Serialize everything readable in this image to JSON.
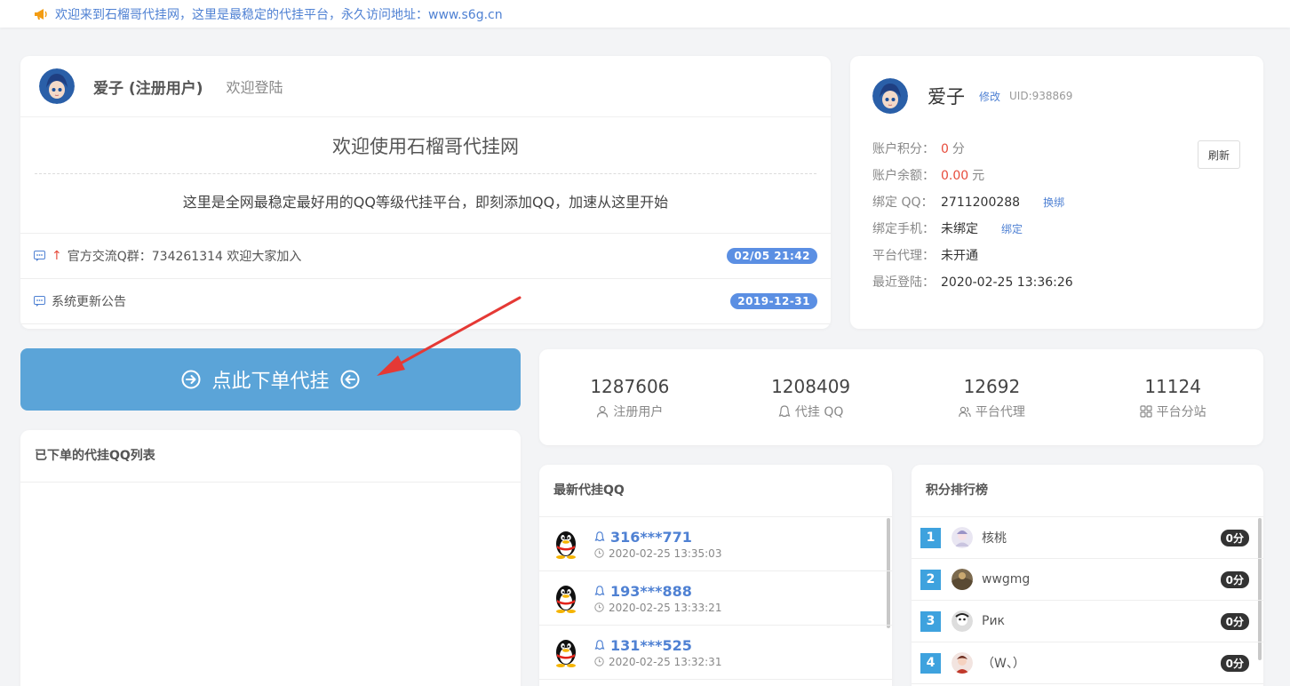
{
  "notice": {
    "text": "欢迎来到石榴哥代挂网，这里是最稳定的代挂平台，永久访问地址：www.s6g.cn"
  },
  "welcome": {
    "user_name": "爱子 (注册用户)",
    "welcome_text": "欢迎登陆",
    "title": "欢迎使用石榴哥代挂网",
    "description": "这里是全网最稳定最好用的QQ等级代挂平台，即刻添加QQ，加速从这里开始",
    "announcements": [
      {
        "text": "官方交流Q群：734261314 欢迎大家加入",
        "date": "02/05 21:42"
      },
      {
        "text": "系统更新公告",
        "date": "2019-12-31"
      }
    ]
  },
  "profile": {
    "name": "爱子",
    "edit_label": "修改",
    "uid": "UID:938869",
    "refresh_label": "刷新",
    "points_label": "账户积分：",
    "points_value": "0",
    "points_unit": "分",
    "balance_label": "账户余额：",
    "balance_value": "0.00",
    "balance_unit": "元",
    "qq_label": "绑定 QQ：",
    "qq_value": "2711200288",
    "qq_action": "换绑",
    "phone_label": "绑定手机：",
    "phone_value": "未绑定",
    "phone_action": "绑定",
    "agent_label": "平台代理：",
    "agent_value": "未开通",
    "login_label": "最近登陆：",
    "login_value": "2020-02-25 13:36:26"
  },
  "order_button": {
    "label": "点此下单代挂"
  },
  "stats": [
    {
      "value": "1287606",
      "label": "注册用户",
      "icon": "user-icon"
    },
    {
      "value": "1208409",
      "label": "代挂 QQ",
      "icon": "qq-icon"
    },
    {
      "value": "12692",
      "label": "平台代理",
      "icon": "users-icon"
    },
    {
      "value": "11124",
      "label": "平台分站",
      "icon": "grid-icon"
    }
  ],
  "order_list": {
    "title": "已下单的代挂QQ列表"
  },
  "latest": {
    "title": "最新代挂QQ",
    "items": [
      {
        "qq": "316***771",
        "time": "2020-02-25 13:35:03"
      },
      {
        "qq": "193***888",
        "time": "2020-02-25 13:33:21"
      },
      {
        "qq": "131***525",
        "time": "2020-02-25 13:32:31"
      }
    ]
  },
  "ranking": {
    "title": "积分排行榜",
    "items": [
      {
        "rank": "1",
        "name": "核桃",
        "score": "0分"
      },
      {
        "rank": "2",
        "name": "wwgmg",
        "score": "0分"
      },
      {
        "rank": "3",
        "name": "Рик",
        "score": "0分"
      },
      {
        "rank": "4",
        "name": "（W、）",
        "score": "0分"
      }
    ]
  },
  "colors": {
    "accent": "#4f81d3",
    "button": "#5ba4d8",
    "badge": "#5b8fe3",
    "rank": "#3ea2de",
    "red": "#e74c3c"
  }
}
